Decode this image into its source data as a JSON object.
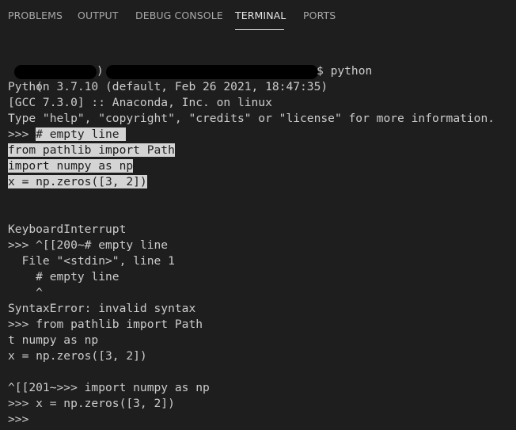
{
  "panel": {
    "tabs": [
      {
        "label": "PROBLEMS",
        "active": false
      },
      {
        "label": "OUTPUT",
        "active": false
      },
      {
        "label": "DEBUG CONSOLE",
        "active": false
      },
      {
        "label": "TERMINAL",
        "active": true
      },
      {
        "label": "PORTS",
        "active": false
      }
    ]
  },
  "terminal": {
    "prompt_open": "(",
    "prompt_close": ")",
    "prompt_command": "$ python",
    "lines": [
      {
        "text": "Python 3.7.10 (default, Feb 26 2021, 18:47:35)",
        "selected": false
      },
      {
        "text": "[GCC 7.3.0] :: Anaconda, Inc. on linux",
        "selected": false
      },
      {
        "text": "Type \"help\", \"copyright\", \"credits\" or \"license\" for more information.",
        "selected": false
      },
      {
        "prefix": ">>> ",
        "text": "# empty line ",
        "selected": true
      },
      {
        "text": "from pathlib import Path",
        "selected": true
      },
      {
        "text": "import numpy as np",
        "selected": true
      },
      {
        "text": "x = np.zeros([3, 2])",
        "selected": true
      },
      {
        "text": "",
        "selected": false
      },
      {
        "text": "",
        "selected": false
      },
      {
        "text": "KeyboardInterrupt",
        "selected": false
      },
      {
        "text": ">>> ^[[200~# empty line",
        "selected": false
      },
      {
        "text": "  File \"<stdin>\", line 1",
        "selected": false
      },
      {
        "text": "    # empty line",
        "selected": false
      },
      {
        "text": "    ^",
        "selected": false
      },
      {
        "text": "SyntaxError: invalid syntax",
        "selected": false
      },
      {
        "text": ">>> from pathlib import Path",
        "selected": false
      },
      {
        "text": "t numpy as np",
        "selected": false
      },
      {
        "text": "x = np.zeros([3, 2])",
        "selected": false
      },
      {
        "text": "",
        "selected": false
      },
      {
        "text": "^[[201~>>> import numpy as np",
        "selected": false
      },
      {
        "text": ">>> x = np.zeros([3, 2])",
        "selected": false
      },
      {
        "text": ">>> ",
        "selected": false
      }
    ]
  },
  "colors": {
    "background": "#1e1e1e",
    "text": "#cccccc",
    "tab_inactive": "#a8a8a8",
    "tab_active": "#e7e7e7",
    "selection_bg": "#d4d4d4",
    "selection_text": "#1e1e1e",
    "redaction": "#000000"
  }
}
